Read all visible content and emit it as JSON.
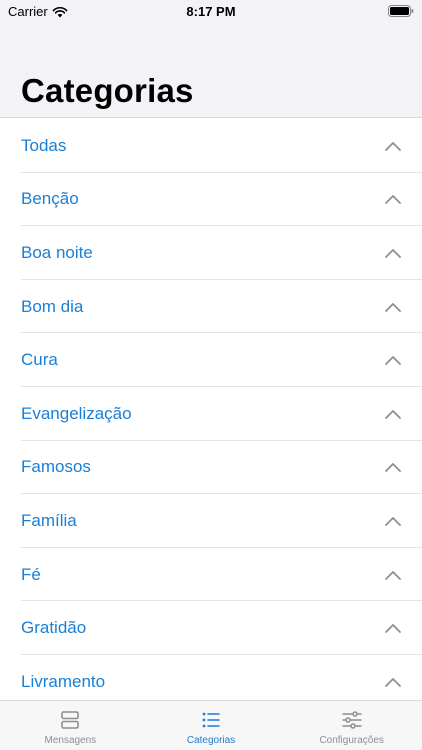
{
  "status_bar": {
    "carrier": "Carrier",
    "time": "8:17 PM"
  },
  "header": {
    "title": "Categorias"
  },
  "categories": [
    {
      "label": "Todas"
    },
    {
      "label": "Benção"
    },
    {
      "label": "Boa noite"
    },
    {
      "label": "Bom dia"
    },
    {
      "label": "Cura"
    },
    {
      "label": "Evangelização"
    },
    {
      "label": "Famosos"
    },
    {
      "label": "Família"
    },
    {
      "label": "Fé"
    },
    {
      "label": "Gratidão"
    },
    {
      "label": "Livramento"
    }
  ],
  "tabbar": {
    "tabs": [
      {
        "label": "Mensagens",
        "icon": "stack-icon",
        "active": false
      },
      {
        "label": "Categorias",
        "icon": "list-icon",
        "active": true
      },
      {
        "label": "Configurações",
        "icon": "sliders-icon",
        "active": false
      }
    ]
  },
  "colors": {
    "accent": "#1a7fd6",
    "inactive": "#8e8e93",
    "header_bg": "#f2f2f7"
  }
}
